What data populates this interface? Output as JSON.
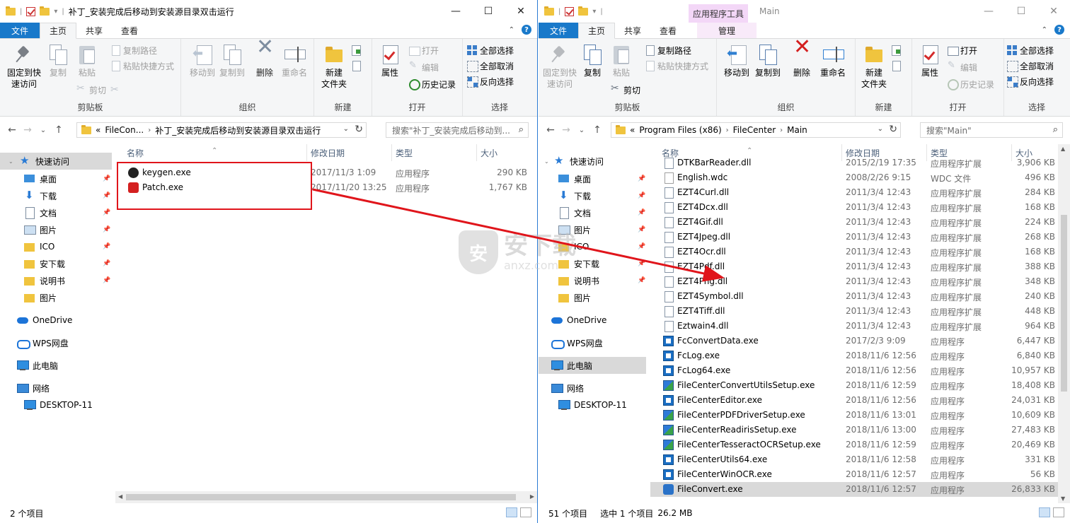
{
  "left": {
    "title": "补丁_安装完成后移动到安装源目录双击运行",
    "tabs": [
      "文件",
      "主页",
      "共享",
      "查看"
    ],
    "ribbon": {
      "clipboard": {
        "pin": "固定到快\n速访问",
        "copy": "复制",
        "paste": "粘贴",
        "copy_path": "复制路径",
        "paste_shortcut": "粘贴快捷方式",
        "cut": "剪切",
        "label": "剪贴板"
      },
      "organize": {
        "move_to": "移动到",
        "copy_to": "复制到",
        "delete": "删除",
        "rename": "重命名",
        "label": "组织"
      },
      "new": {
        "new_folder": "新建\n文件夹",
        "label": "新建"
      },
      "open": {
        "properties": "属性",
        "open": "打开",
        "edit": "编辑",
        "history": "历史记录",
        "label": "打开"
      },
      "select": {
        "select_all": "全部选择",
        "select_none": "全部取消",
        "invert": "反向选择",
        "label": "选择"
      }
    },
    "address": {
      "prefix": "«",
      "crumb1": "FileCon...",
      "crumb2": "补丁_安装完成后移动到安装源目录双击运行"
    },
    "search_placeholder": "搜索\"补丁_安装完成后移动到...",
    "columns": {
      "name": "名称",
      "date": "修改日期",
      "type": "类型",
      "size": "大小"
    },
    "files": [
      {
        "name": "keygen.exe",
        "date": "2017/11/3 1:09",
        "type": "应用程序",
        "size": "290 KB",
        "icon": "skull-icon"
      },
      {
        "name": "Patch.exe",
        "date": "2017/11/20 13:25",
        "type": "应用程序",
        "size": "1,767 KB",
        "icon": "patch-icon"
      }
    ],
    "status": "2 个项目"
  },
  "right": {
    "title": "Main",
    "context_tab": "应用程序工具",
    "tabs": [
      "文件",
      "主页",
      "共享",
      "查看",
      "管理"
    ],
    "ribbon": {
      "clipboard": {
        "pin": "固定到快\n速访问",
        "copy": "复制",
        "paste": "粘贴",
        "copy_path": "复制路径",
        "paste_shortcut": "粘贴快捷方式",
        "cut": "剪切",
        "label": "剪贴板"
      },
      "organize": {
        "move_to": "移动到",
        "copy_to": "复制到",
        "delete": "删除",
        "rename": "重命名",
        "label": "组织"
      },
      "new": {
        "new_folder": "新建\n文件夹",
        "label": "新建"
      },
      "open": {
        "properties": "属性",
        "open": "打开",
        "edit": "编辑",
        "history": "历史记录",
        "label": "打开"
      },
      "select": {
        "select_all": "全部选择",
        "select_none": "全部取消",
        "invert": "反向选择",
        "label": "选择"
      }
    },
    "address": {
      "prefix": "«",
      "crumb1": "Program Files (x86)",
      "crumb2": "FileCenter",
      "crumb3": "Main"
    },
    "search_placeholder": "搜索\"Main\"",
    "columns": {
      "name": "名称",
      "date": "修改日期",
      "type": "类型",
      "size": "大小"
    },
    "files": [
      {
        "name": "DTKBarReader.dll",
        "date": "2015/2/19 17:35",
        "type": "应用程序扩展",
        "size": "3,906 KB",
        "icon": "dll-icon"
      },
      {
        "name": "English.wdc",
        "date": "2008/2/26 9:15",
        "type": "WDC 文件",
        "size": "496 KB",
        "icon": "wdc-icon"
      },
      {
        "name": "EZT4Curl.dll",
        "date": "2011/3/4 12:43",
        "type": "应用程序扩展",
        "size": "284 KB",
        "icon": "dll-icon"
      },
      {
        "name": "EZT4Dcx.dll",
        "date": "2011/3/4 12:43",
        "type": "应用程序扩展",
        "size": "168 KB",
        "icon": "dll-icon"
      },
      {
        "name": "EZT4Gif.dll",
        "date": "2011/3/4 12:43",
        "type": "应用程序扩展",
        "size": "224 KB",
        "icon": "dll-icon"
      },
      {
        "name": "EZT4Jpeg.dll",
        "date": "2011/3/4 12:43",
        "type": "应用程序扩展",
        "size": "268 KB",
        "icon": "dll-icon"
      },
      {
        "name": "EZT4Ocr.dll",
        "date": "2011/3/4 12:43",
        "type": "应用程序扩展",
        "size": "168 KB",
        "icon": "dll-icon"
      },
      {
        "name": "EZT4Pdf.dll",
        "date": "2011/3/4 12:43",
        "type": "应用程序扩展",
        "size": "388 KB",
        "icon": "dll-icon"
      },
      {
        "name": "EZT4Png.dll",
        "date": "2011/3/4 12:43",
        "type": "应用程序扩展",
        "size": "348 KB",
        "icon": "dll-icon"
      },
      {
        "name": "EZT4Symbol.dll",
        "date": "2011/3/4 12:43",
        "type": "应用程序扩展",
        "size": "240 KB",
        "icon": "dll-icon"
      },
      {
        "name": "EZT4Tiff.dll",
        "date": "2011/3/4 12:43",
        "type": "应用程序扩展",
        "size": "448 KB",
        "icon": "dll-icon"
      },
      {
        "name": "Eztwain4.dll",
        "date": "2011/3/4 12:43",
        "type": "应用程序扩展",
        "size": "964 KB",
        "icon": "dll-icon"
      },
      {
        "name": "FcConvertData.exe",
        "date": "2017/2/3 9:09",
        "type": "应用程序",
        "size": "6,447 KB",
        "icon": "exe-icon"
      },
      {
        "name": "FcLog.exe",
        "date": "2018/11/6 12:56",
        "type": "应用程序",
        "size": "6,840 KB",
        "icon": "exe-icon"
      },
      {
        "name": "FcLog64.exe",
        "date": "2018/11/6 12:56",
        "type": "应用程序",
        "size": "10,957 KB",
        "icon": "exe-icon"
      },
      {
        "name": "FileCenterConvertUtilsSetup.exe",
        "date": "2018/11/6 12:59",
        "type": "应用程序",
        "size": "18,408 KB",
        "icon": "setup-icon"
      },
      {
        "name": "FileCenterEditor.exe",
        "date": "2018/11/6 12:56",
        "type": "应用程序",
        "size": "24,031 KB",
        "icon": "exe-icon"
      },
      {
        "name": "FileCenterPDFDriverSetup.exe",
        "date": "2018/11/6 13:01",
        "type": "应用程序",
        "size": "10,609 KB",
        "icon": "setup-icon"
      },
      {
        "name": "FileCenterReadirisSetup.exe",
        "date": "2018/11/6 13:00",
        "type": "应用程序",
        "size": "27,483 KB",
        "icon": "setup-icon"
      },
      {
        "name": "FileCenterTesseractOCRSetup.exe",
        "date": "2018/11/6 12:59",
        "type": "应用程序",
        "size": "20,469 KB",
        "icon": "setup-icon"
      },
      {
        "name": "FileCenterUtils64.exe",
        "date": "2018/11/6 12:58",
        "type": "应用程序",
        "size": "331 KB",
        "icon": "exe-icon"
      },
      {
        "name": "FileCenterWinOCR.exe",
        "date": "2018/11/6 12:57",
        "type": "应用程序",
        "size": "56 KB",
        "icon": "exe-icon"
      },
      {
        "name": "FileConvert.exe",
        "date": "2018/11/6 12:57",
        "type": "应用程序",
        "size": "26,833 KB",
        "icon": "convert-icon",
        "selected": true
      }
    ],
    "status_count": "51 个项目",
    "status_selected": "选中 1 个项目",
    "status_size": "26.2 MB"
  },
  "navpane": {
    "quick_access": "快速访问",
    "items": [
      "桌面",
      "下载",
      "文档",
      "图片",
      "ICO",
      "安下载",
      "说明书",
      "图片"
    ],
    "onedrive": "OneDrive",
    "wps": "WPS网盘",
    "thispc": "此电脑",
    "network": "网络",
    "desktop_pc": "DESKTOP-11"
  },
  "watermark": {
    "text": "安下载",
    "sub": "anxz.com",
    "badge": "安"
  },
  "colors": {
    "accent": "#1979ca",
    "highlight_red": "#e0151b",
    "context_tab": "#f3d7f7"
  }
}
